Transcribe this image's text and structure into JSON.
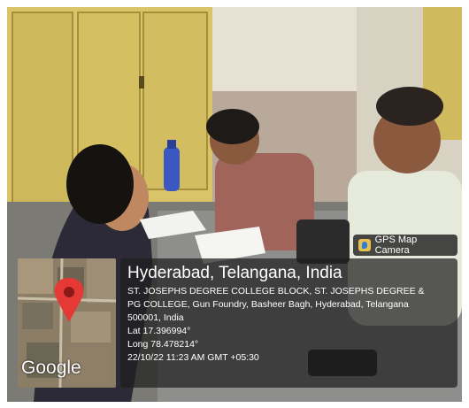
{
  "badge": {
    "app_name": "GPS Map Camera",
    "icon": "gps-map-camera-icon"
  },
  "location": {
    "city": "Hyderabad, Telangana, India",
    "address_line1": "ST. JOSEPHS DEGREE COLLEGE BLOCK, ST. JOSEPHS DEGREE &",
    "address_line2": "PG COLLEGE, Gun Foundry, Basheer Bagh, Hyderabad, Telangana",
    "address_line3": "500001, India",
    "lat": "Lat 17.396994°",
    "long": "Long 78.478214°",
    "datetime": "22/10/22 11:23 AM GMT +05:30"
  },
  "map": {
    "watermark": "Google",
    "pin_color": "#e53935"
  }
}
